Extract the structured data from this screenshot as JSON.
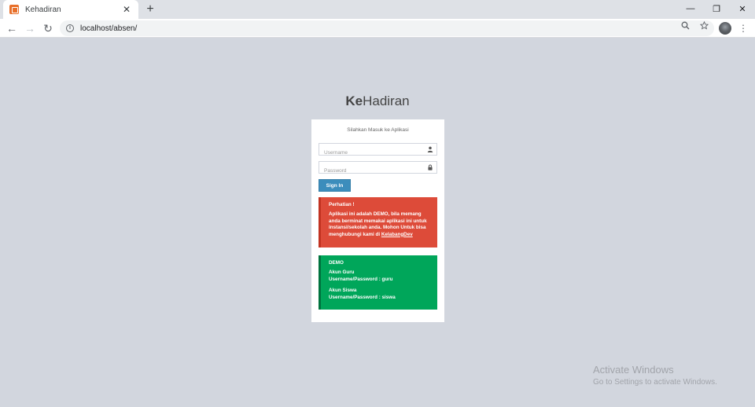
{
  "browser": {
    "tab_title": "Kehadiran",
    "tab_close": "✕",
    "new_tab": "+",
    "url": "localhost/absen/",
    "controls": {
      "minimize": "—",
      "restore": "❐",
      "close": "✕"
    },
    "nav": {
      "back": "←",
      "forward": "→",
      "reload": "↻"
    }
  },
  "page": {
    "logo_bold": "Ke",
    "logo_rest": "Hadiran",
    "login_msg": "Silahkan Masuk ke Aplikasi",
    "username_placeholder": "Username",
    "password_placeholder": "Password",
    "signin_label": "Sign In",
    "warning": {
      "title": "Perhatian !",
      "body": "Aplikasi ini adalah DEMO, bila memang anda berminat memakai aplikasi ini untuk instansi/sekolah anda. Mohon Untuk bisa menghubungi kami di ",
      "link": "KelabangDev"
    },
    "demo": {
      "title": "DEMO",
      "accounts": [
        {
          "name": "Akun Guru",
          "cred": "Username/Password : guru"
        },
        {
          "name": "Akun Siswa",
          "cred": "Username/Password : siswa"
        }
      ]
    }
  },
  "watermark": {
    "line1": "Activate Windows",
    "line2": "Go to Settings to activate Windows."
  },
  "colors": {
    "page_bg": "#d2d6de",
    "primary": "#3c8dbc",
    "danger": "#dd4b39",
    "success": "#00a65a"
  }
}
